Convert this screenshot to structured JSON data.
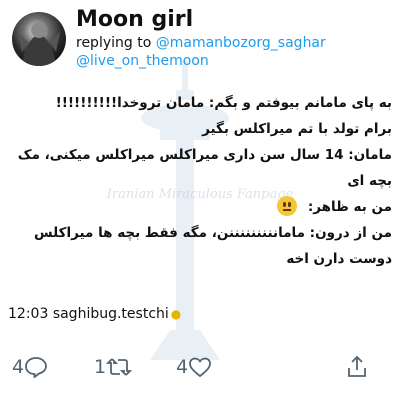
{
  "user": {
    "name": "Moon girl"
  },
  "reply": {
    "prefix": "replying to",
    "handle1": "@mamanbozorg_saghar",
    "handle2": "@live_on_themoon"
  },
  "tweet": {
    "lines": [
      "به پای مامانم بیوفتم و بگم: مامان تروخدا!!!!!!!!!!",
      "برام تولد با تم میراکلس بگیر",
      "مامان: 14 سال سن داری میراکلس میراکلس میکنی، مک بچه ای",
      "من به ظاهر:",
      "من از درون: مامانننننننننن، مگه فقط بچه ها میراکلس دوست دارن اخه"
    ]
  },
  "watermark": {
    "line1": "Iranian Miraculous Fanpage"
  },
  "footer": {
    "time": "12:03",
    "source": "saghibug.testchi"
  },
  "actions": {
    "replies": "4",
    "retweets": "1",
    "likes": "4"
  },
  "colors": {
    "link": "#1d9bf0",
    "icon": "#536471",
    "text": "#111111"
  },
  "icons": [
    "reply-icon",
    "retweet-icon",
    "like-icon",
    "share-icon",
    "lightbulb-icon",
    "neutral-face-emoji"
  ]
}
